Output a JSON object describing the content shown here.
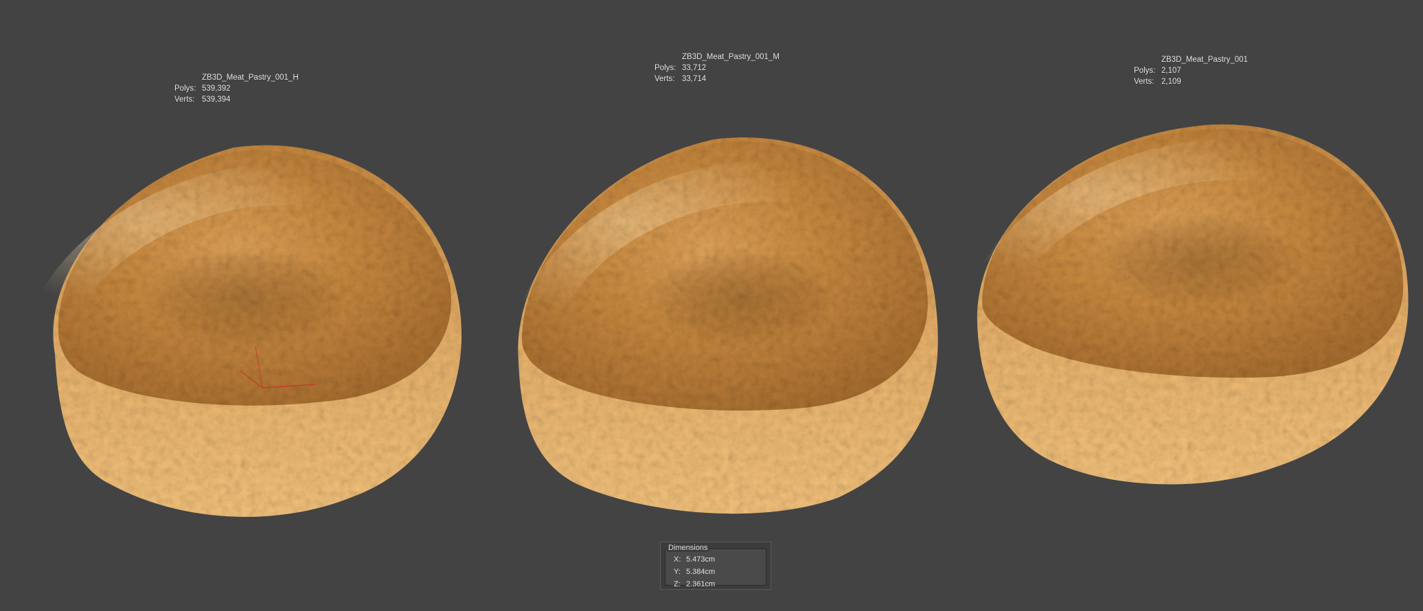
{
  "models": [
    {
      "name": "ZB3D_Meat_Pastry_001_H",
      "polys_label": "Polys:",
      "polys": "539,392",
      "verts_label": "Verts:",
      "verts": "539,394"
    },
    {
      "name": "ZB3D_Meat_Pastry_001_M",
      "polys_label": "Polys:",
      "polys": "33,712",
      "verts_label": "Verts:",
      "verts": "33,714"
    },
    {
      "name": "ZB3D_Meat_Pastry_001",
      "polys_label": "Polys:",
      "polys": "2,107",
      "verts_label": "Verts:",
      "verts": "2,109"
    }
  ],
  "dimensions": {
    "title": "Dimensions",
    "x_label": "X:",
    "x": "5.473cm",
    "y_label": "Y:",
    "y": "5.384cm",
    "z_label": "Z:",
    "z": "2.361cm"
  },
  "colors": {
    "viewport_bg": "#434343",
    "pastry_light": "#f4c27a",
    "pastry_mid": "#d99a4c",
    "pastry_dark": "#9a6428"
  }
}
